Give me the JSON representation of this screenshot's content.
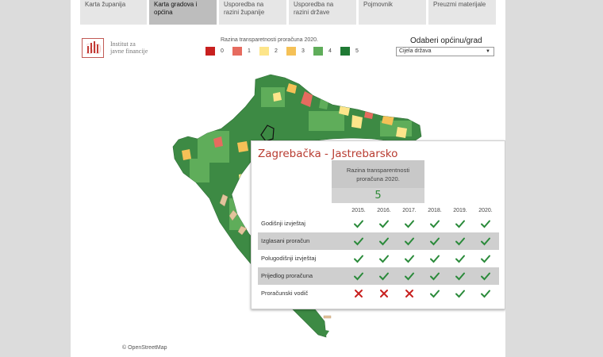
{
  "tabs": [
    {
      "label": "Karta županija",
      "active": false
    },
    {
      "label": "Karta gradova i općina",
      "active": true
    },
    {
      "label": "Usporedba na razini županije",
      "active": false
    },
    {
      "label": "Usporedba na razini države",
      "active": false
    },
    {
      "label": "Pojmovnik",
      "active": false
    },
    {
      "label": "Preuzmi materijale",
      "active": false
    }
  ],
  "logo": {
    "line1": "Institut za",
    "line2": "javne financije"
  },
  "legend": {
    "title": "Razina transparetnosti proračuna 2020.",
    "items": [
      {
        "label": "0",
        "color": "#c8201f"
      },
      {
        "label": "1",
        "color": "#e66b5f"
      },
      {
        "label": "2",
        "color": "#fde58a"
      },
      {
        "label": "3",
        "color": "#f5c157"
      },
      {
        "label": "4",
        "color": "#5fad5a"
      },
      {
        "label": "5",
        "color": "#1f7a34"
      }
    ]
  },
  "selector": {
    "label": "Odaberi općinu/grad",
    "value": "Cijela država"
  },
  "attribution": "© OpenStreetMap",
  "tooltip": {
    "title": "Zagrebačka - Jastrebarsko",
    "score_label_line1": "Razina transparentnosti",
    "score_label_line2": "proračuna  2020.",
    "score": "5",
    "years": [
      "2015.",
      "2016.",
      "2017.",
      "2018.",
      "2019.",
      "2020."
    ],
    "rows": [
      {
        "label": "Godišnji izvještaj",
        "values": [
          "check",
          "check",
          "check",
          "check",
          "check",
          "check"
        ]
      },
      {
        "label": "Izglasani proračun",
        "values": [
          "check",
          "check",
          "check",
          "check",
          "check",
          "check"
        ]
      },
      {
        "label": "Polugodišnji izvještaj",
        "values": [
          "check",
          "check",
          "check",
          "check",
          "check",
          "check"
        ]
      },
      {
        "label": "Prijedlog proračuna",
        "values": [
          "check",
          "check",
          "check",
          "check",
          "check",
          "check"
        ]
      },
      {
        "label": "Proračunski vodič",
        "values": [
          "cross",
          "cross",
          "cross",
          "check",
          "check",
          "check"
        ]
      }
    ]
  },
  "colors": {
    "check": "#2a8a3a",
    "cross": "#c8201f",
    "title": "#b83b30"
  }
}
